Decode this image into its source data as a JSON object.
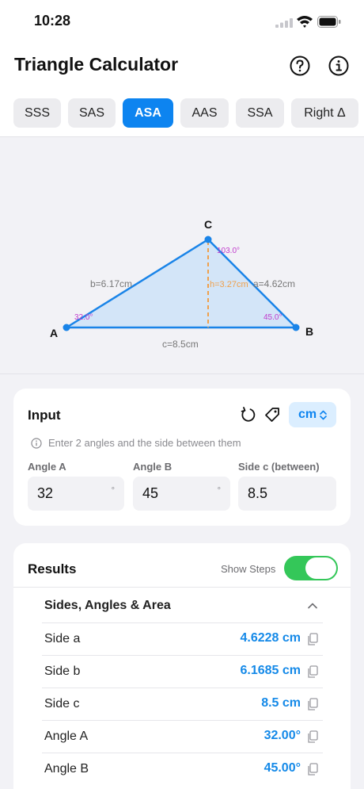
{
  "status_bar": {
    "time": "10:28"
  },
  "header": {
    "title": "Triangle Calculator",
    "help_icon": "question-circle-icon",
    "info_icon": "info-circle-icon"
  },
  "tabs": [
    {
      "label": "SSS",
      "active": false
    },
    {
      "label": "SAS",
      "active": false
    },
    {
      "label": "ASA",
      "active": true
    },
    {
      "label": "AAS",
      "active": false
    },
    {
      "label": "SSA",
      "active": false
    },
    {
      "label": "Right Δ",
      "active": false
    }
  ],
  "diagram": {
    "vertex_a": "A",
    "vertex_b": "B",
    "vertex_c": "C",
    "side_a": "a=4.62cm",
    "side_b": "b=6.17cm",
    "side_c": "c=8.5cm",
    "height": "h=3.27cm",
    "angle_a": "32.0°",
    "angle_b": "45.0°",
    "angle_c": "103.0°"
  },
  "input": {
    "title": "Input",
    "unit": "cm",
    "hint": "Enter 2 angles and the side between them",
    "fields": [
      {
        "label": "Angle A",
        "value": "32",
        "suffix": "°"
      },
      {
        "label": "Angle B",
        "value": "45",
        "suffix": "°"
      },
      {
        "label": "Side c (between)",
        "value": "8.5",
        "suffix": ""
      }
    ]
  },
  "results": {
    "title": "Results",
    "show_steps_label": "Show Steps",
    "show_steps_on": true,
    "section_title": "Sides, Angles & Area",
    "rows": [
      {
        "label": "Side a",
        "value": "4.6228 cm"
      },
      {
        "label": "Side b",
        "value": "6.1685 cm"
      },
      {
        "label": "Side c",
        "value": "8.5 cm"
      },
      {
        "label": "Angle A",
        "value": "32.00°"
      },
      {
        "label": "Angle B",
        "value": "45.00°"
      }
    ]
  },
  "colors": {
    "accent": "#0d84f0",
    "toggle_on": "#34c759",
    "triangle_fill": "#d3e5f8",
    "height_line": "#f0a04b",
    "angle_label": "#c03ccc"
  }
}
